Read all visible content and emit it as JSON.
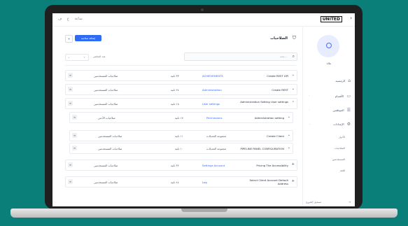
{
  "topbar": {
    "left_items": [
      "ساعة",
      "ع",
      "ف"
    ],
    "brand": "UNITED"
  },
  "sidebar": {
    "user_name": "علاء",
    "items": [
      {
        "label": "الرئيسية",
        "icon": "home-icon"
      },
      {
        "label": "الأقسام",
        "icon": "folder-icon"
      },
      {
        "label": "الموظفين",
        "icon": "list-icon"
      },
      {
        "label": "الإعدادات",
        "icon": "gear-icon"
      }
    ],
    "sub_items": [
      "الأدوار",
      "الصلاحيات",
      "المستخدمين",
      "اللغة"
    ],
    "footer": "تسجيل الخروج"
  },
  "main": {
    "primary_button": "إضافة صلاحية",
    "square_button": "+",
    "title": "الصلاحيات",
    "filter_value": "١٠",
    "filter_label": "عدد العناصر",
    "search_placeholder": "بحث...",
    "rows": [
      {
        "c1": "صلاحيات المستخدمين",
        "c2": "٣٣ ثانية",
        "c3": "ACHIEVEMENTS",
        "c4": "Create REST API",
        "expanded": false
      },
      {
        "c1": "صلاحيات المستخدمين",
        "c2": "٢٤ ثانية",
        "c3": "Administration",
        "c4": "Create REST",
        "expanded": false
      },
      {
        "c1": "صلاحيات المستخدمين",
        "c2": "١٨ ثانية",
        "c3": "User settings",
        "c4": "Administration Setting User settings",
        "expanded": true
      }
    ],
    "nested_rows": [
      {
        "c1": "صلاحيات الأدمن",
        "c2": "١٧ ثانية",
        "c3": "Permissions",
        "c4": "Administration setting"
      },
      {
        "c1": "صلاحيات المستخدمين",
        "c2": "١١ ثانية",
        "c3": "مجموعة التعديلات",
        "c4": "Create Client"
      },
      {
        "c1": "صلاحيات المستخدمين",
        "c2": "١٠ ثانية",
        "c3": "مجموعة التعديلات",
        "c4": "PIPELINE PANEL CONFIGURATION"
      }
    ],
    "bottom_rows": [
      {
        "c1": "صلاحيات المستخدمين",
        "c2": "٣٢ ثانية",
        "c3": "Settings Account",
        "c4": "Pricing The Accessibility"
      },
      {
        "c1": "صلاحيات المستخدمين",
        "c2": "٤٤ ثانية",
        "c3": "Log",
        "c4": "Select Client Account Default Address"
      }
    ]
  }
}
